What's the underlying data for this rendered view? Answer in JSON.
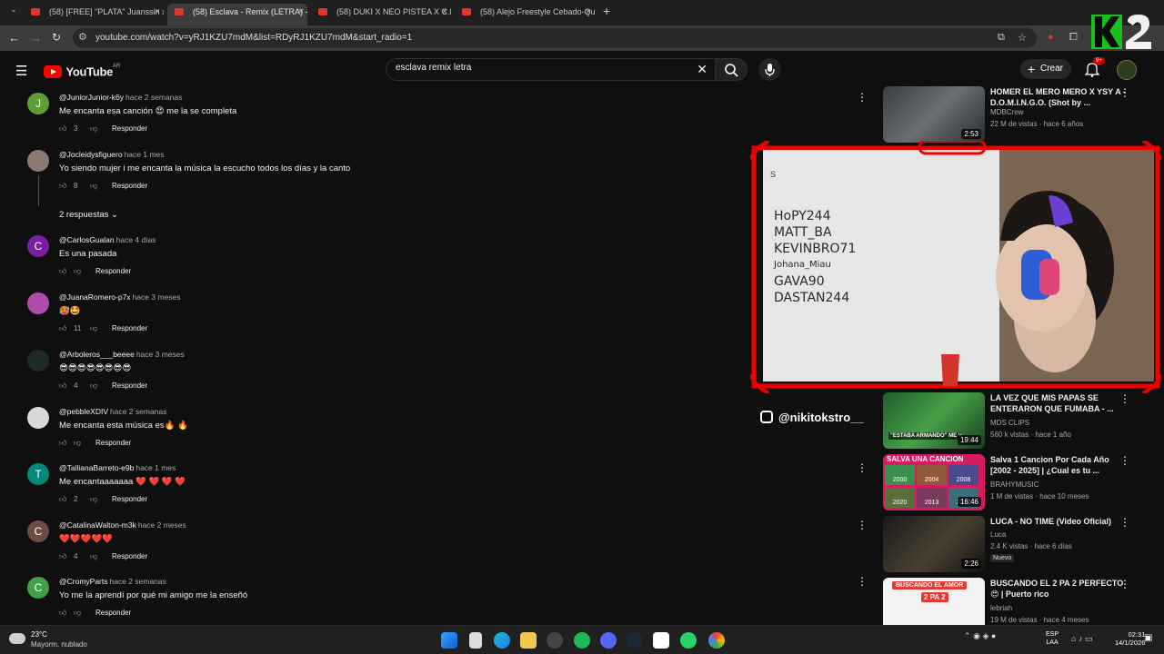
{
  "browser": {
    "tabs": [
      {
        "title": "(58) [FREE] \"PLATA\" Juanssin x L",
        "active": false
      },
      {
        "title": "(58) Esclava - Remix (LETRA) - Y",
        "active": true
      },
      {
        "title": "(58) DUKI X NEO PISTEA X C.R.O",
        "active": false
      },
      {
        "title": "(58) Alejo Freestyle Cebado-Qu",
        "active": false
      }
    ],
    "url": "youtube.com/watch?v=yRJ1KZU7mdM&list=RDyRJ1KZU7mdM&start_radio=1"
  },
  "youtube": {
    "logo": "YouTube",
    "country": "AR",
    "search_value": "esclava remix letra",
    "create_label": "Crear",
    "notifications_badge": "9+"
  },
  "comments": [
    {
      "author": "@JuniorJunior-k6y",
      "time": "hace 2 semanas",
      "text": "Me encanta esa canción 😍 me la se completa",
      "likes": "3",
      "reply": "Responder",
      "avatar_letter": "J",
      "avatar_color": "#5c9e2f"
    },
    {
      "author": "@Jocleidysfiguero",
      "time": "hace 1 mes",
      "text": "Yo siendo mujer i me encanta la música la escucho todos los días y la canto",
      "likes": "8",
      "reply": "Responder",
      "avatar_letter": "",
      "avatar_color": "#8a7a70"
    },
    {
      "author": "@CarlosGualan",
      "time": "hace 4 días",
      "text": "Es una pasada",
      "likes": "",
      "reply": "Responder",
      "avatar_letter": "C",
      "avatar_color": "#7b1fa2"
    },
    {
      "author": "@JuanaRomero-p7x",
      "time": "hace 3 meses",
      "text": "🥵🤩",
      "likes": "11",
      "reply": "Responder",
      "avatar_letter": "",
      "avatar_color": "#b04aa8"
    },
    {
      "author": "@Arboleros___beeee",
      "time": "hace 3 meses",
      "text": "😎😎😎😎😎😎😎😎",
      "likes": "4",
      "reply": "Responder",
      "avatar_letter": "",
      "avatar_color": "#1d2b27"
    },
    {
      "author": "@pebbleXDIV",
      "time": "hace 2 semanas",
      "text": "Me encanta esta música es🔥 🔥",
      "likes": "",
      "reply": "Responder",
      "avatar_letter": "",
      "avatar_color": "#d8d8d8"
    },
    {
      "author": "@TallianaBarreto-e9b",
      "time": "hace 1 mes",
      "text": "Me encantaaaaaaa ❤️ ❤️ ❤️ ❤️",
      "likes": "2",
      "reply": "Responder",
      "avatar_letter": "T",
      "avatar_color": "#00897b"
    },
    {
      "author": "@CatalinaWalton-m3k",
      "time": "hace 2 meses",
      "text": "❤️❤️❤️❤️❤️",
      "likes": "4",
      "reply": "Responder",
      "avatar_letter": "C",
      "avatar_color": "#6d4c41"
    },
    {
      "author": "@CromyParts",
      "time": "hace 2 semanas",
      "text": "Yo me la aprendí por qué mi amigo me la enseñó",
      "likes": "",
      "reply": "Responder",
      "avatar_letter": "C",
      "avatar_color": "#43a047"
    }
  ],
  "replies_toggle": "2 respuestas",
  "related": [
    {
      "title": "HOMER EL MERO MERO X YSY A - D.O.M.I.N.G.O. (Shot by ...",
      "channel": "MDBCrew",
      "meta": "22 M de vistas · hace 6 años",
      "duration": "2:53",
      "badge": ""
    },
    {
      "title": "LA VEZ QUE MIS PAPAS SE ENTERARON QUE FUMABA - ...",
      "channel": "MDS CLIPS",
      "meta": "560 k vistas · hace 1 año",
      "duration": "19:44",
      "badge": ""
    },
    {
      "title": "Salva 1 Cancion Por Cada Año [2002 - 2025] | ¿Cual es tu ...",
      "channel": "BRAHYMUSIC",
      "meta": "1 M de vistas · hace 10 meses",
      "duration": "16:46",
      "badge": ""
    },
    {
      "title": "LUCA - NO TIME (Video Oficial)",
      "channel": "Luca",
      "meta": "2.4 K vistas · hace 6 días",
      "duration": "2:26",
      "badge": "Nuevo"
    },
    {
      "title": "BUSCANDO EL 2 PA 2 PERFECTO 😍 | Puerto rico",
      "channel": "lebriah",
      "meta": "19 M de vistas · hace 4 meses",
      "duration": "",
      "badge": ""
    }
  ],
  "overlay": {
    "instagram": "@nikitokstro__",
    "whiteboard": [
      "HoPY244",
      "MATT_BA",
      "KEVINBRO71",
      "Johana_Miau",
      "GAVA90",
      "DASTAN244"
    ],
    "thumb_texts": {
      "salva": "SALVA UNA CANCION",
      "years": [
        "2000",
        "2004",
        "2008",
        "2020",
        "2013",
        "2012"
      ],
      "estaba": "\"ESTABA ARMANDO\" ME VIERON MIS VIE...",
      "buscando": "BUSCANDO EL AMOR",
      "pa2": "2 PA 2"
    }
  },
  "taskbar": {
    "temp": "23°C",
    "weather": "Mayorm. nublado",
    "lang1": "ESP",
    "lang2": "LAA",
    "time": "02:31",
    "date": "14/1/2026"
  }
}
